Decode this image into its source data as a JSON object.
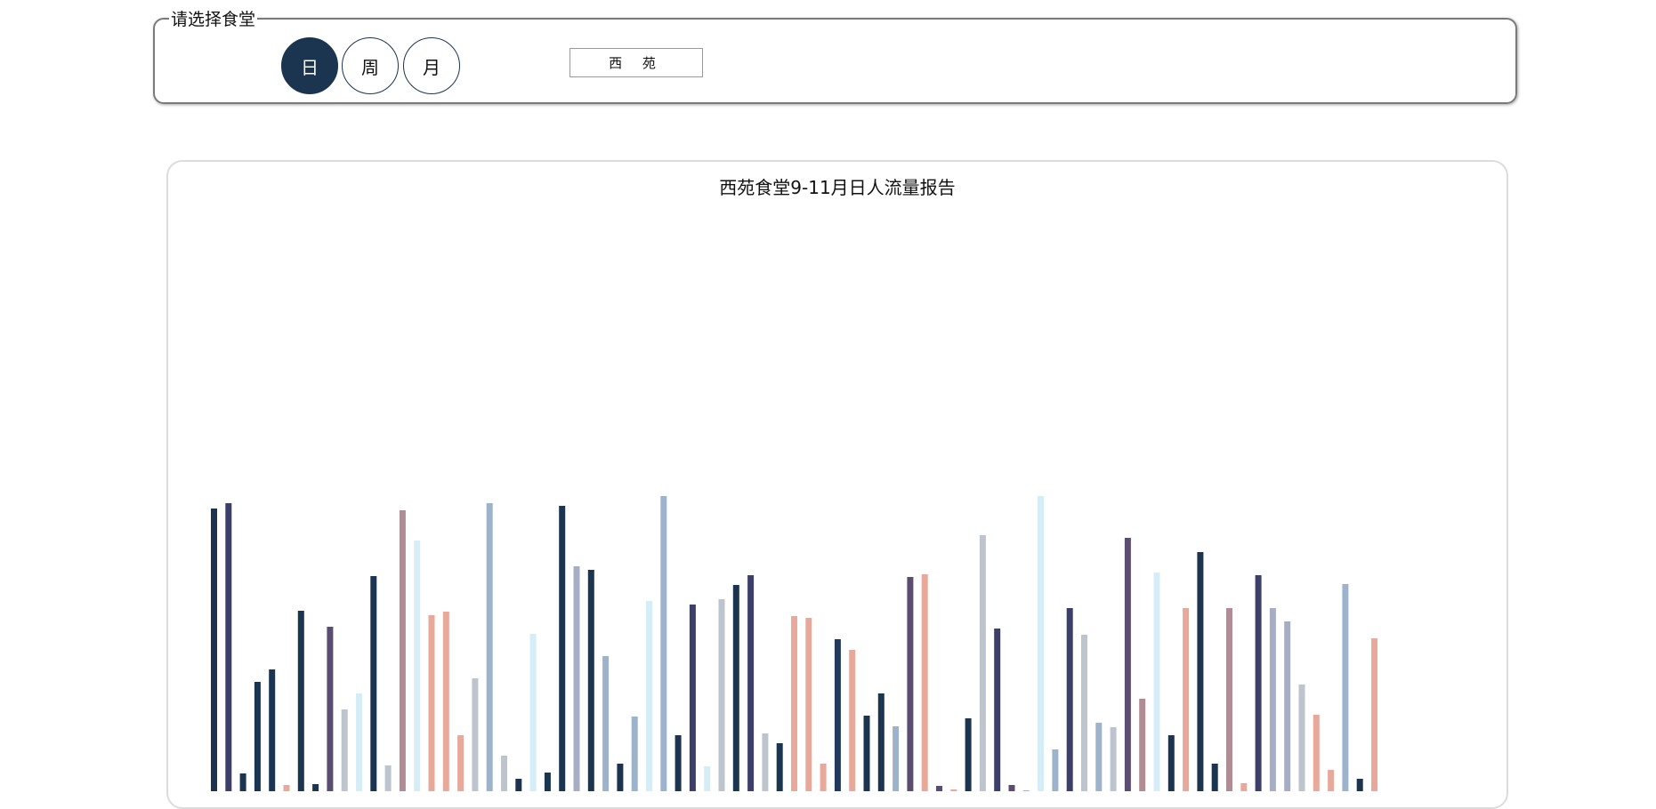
{
  "filter": {
    "legend": "请选择食堂",
    "periods": [
      "日",
      "周",
      "月"
    ],
    "active_period": "日",
    "canteen": "西 苑"
  },
  "chart_data": {
    "type": "bar",
    "title": "西苑食堂9-11月日人流量报告",
    "values": [
      318,
      324,
      20,
      123,
      137,
      7,
      203,
      8,
      185,
      92,
      110,
      242,
      29,
      316,
      282,
      198,
      202,
      63,
      127,
      324,
      40,
      14,
      177,
      21,
      321,
      253,
      249,
      152,
      31,
      84,
      214,
      332,
      63,
      210,
      28,
      216,
      232,
      243,
      65,
      54,
      197,
      195,
      31,
      171,
      159,
      85,
      110,
      73,
      241,
      244,
      6,
      2,
      82,
      288,
      183,
      7,
      1,
      332,
      47,
      206,
      176,
      77,
      72,
      285,
      104,
      246,
      63,
      206,
      269,
      31,
      206,
      9,
      243,
      206,
      191,
      120,
      86,
      24,
      233,
      14,
      172
    ],
    "colors": [
      "#1b3550",
      "#3d3f6b",
      "#5b4c72",
      "#b08c94",
      "#e8a99a",
      "#d5edf7",
      "#9db3cc",
      "#a5aec4",
      "#bec4ce",
      "#22385c"
    ],
    "bar_colors": [
      0,
      1,
      0,
      0,
      0,
      4,
      0,
      0,
      2,
      8,
      5,
      0,
      8,
      3,
      5,
      4,
      4,
      4,
      8,
      6,
      8,
      0,
      5,
      0,
      0,
      7,
      0,
      6,
      0,
      6,
      5,
      6,
      0,
      1,
      5,
      8,
      0,
      1,
      8,
      0,
      4,
      4,
      4,
      9,
      4,
      0,
      0,
      6,
      2,
      4,
      2,
      4,
      0,
      8,
      1,
      2,
      6,
      5,
      6,
      1,
      8,
      6,
      8,
      2,
      3,
      5,
      0,
      4,
      0,
      0,
      3,
      4,
      1,
      7,
      7,
      8,
      4,
      4,
      6,
      0,
      4,
      8
    ]
  }
}
